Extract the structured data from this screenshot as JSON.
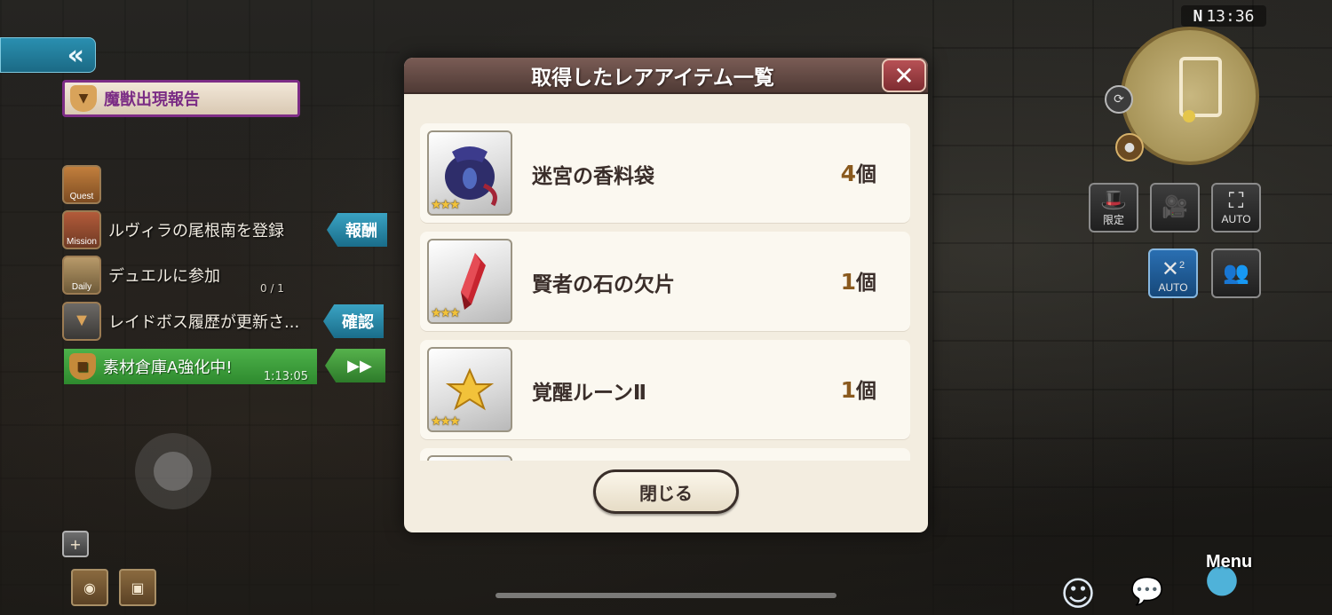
{
  "dialog": {
    "title": "取得したレアアイテム一覧",
    "close_icon": "close-x-icon",
    "close_button_label": "閉じる",
    "items": [
      {
        "name": "迷宮の香料袋",
        "count": "4",
        "unit": "個",
        "stars": "★★★",
        "icon": "pouch-icon"
      },
      {
        "name": "賢者の石の欠片",
        "count": "1",
        "unit": "個",
        "stars": "★★★",
        "icon": "red-crystal-icon"
      },
      {
        "name": "覚醒ルーンⅡ",
        "count": "1",
        "unit": "個",
        "stars": "★★★",
        "icon": "gold-star-icon"
      }
    ]
  },
  "hud": {
    "collapse_label": "«",
    "report_label": "魔獣出現報告",
    "rows": [
      {
        "icon_label": "Quest"
      },
      {
        "icon_label": "Mission",
        "text": "ルヴィラの尾根南を登録",
        "action": "報酬"
      },
      {
        "icon_label": "Daily",
        "text": "デュエルに参加",
        "progress": "0 / 1"
      },
      {
        "text": "レイドボス履歴が更新さ...",
        "action": "確認"
      }
    ],
    "material": {
      "text": "素材倉庫A強化中!",
      "time": "1:13:05",
      "action": "▶▶"
    }
  },
  "right_hud": {
    "clock": "13:36",
    "compass": "N",
    "buttons": [
      {
        "label": "限定",
        "icon": "top-hat-icon"
      },
      {
        "label": "",
        "icon": "camera-icon"
      },
      {
        "label": "AUTO",
        "icon": "auto-camera-icon"
      },
      {
        "label": "AUTO",
        "icon": "auto-x2-icon",
        "badge": "2"
      },
      {
        "label": "",
        "icon": "party-icon"
      }
    ],
    "menu_label": "Menu"
  },
  "colors": {
    "header": "#5e4540",
    "panel": "#f3ede0",
    "close_button": "#9c3c41",
    "star": "#f2c23a"
  }
}
